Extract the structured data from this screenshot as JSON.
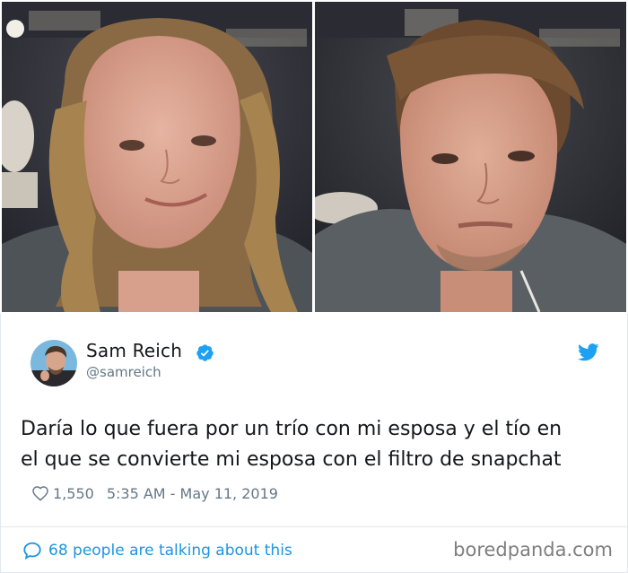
{
  "photos": {
    "left_alt": "",
    "right_alt": ""
  },
  "tweet": {
    "display_name": "Sam Reich",
    "handle": "@samreich",
    "text_lines": [
      "Daría lo que fuera por un trío con mi esposa y el tío en",
      "el que se convierte mi esposa con el filtro de snapchat"
    ],
    "like_count": "1,550",
    "timestamp": "5:35 AM - May 11, 2019",
    "conversation_text": "68 people are talking about this",
    "icons": {
      "verified": "verified-badge-icon",
      "platform": "twitter-bird-icon",
      "like": "heart-icon",
      "reply": "speech-bubble-icon"
    }
  },
  "watermark": "boredpanda.com",
  "colors": {
    "accent": "#1da1f2",
    "link": "#1b95e0",
    "muted": "#657786",
    "text": "#14171a",
    "watermark": "#7f7f7f"
  }
}
